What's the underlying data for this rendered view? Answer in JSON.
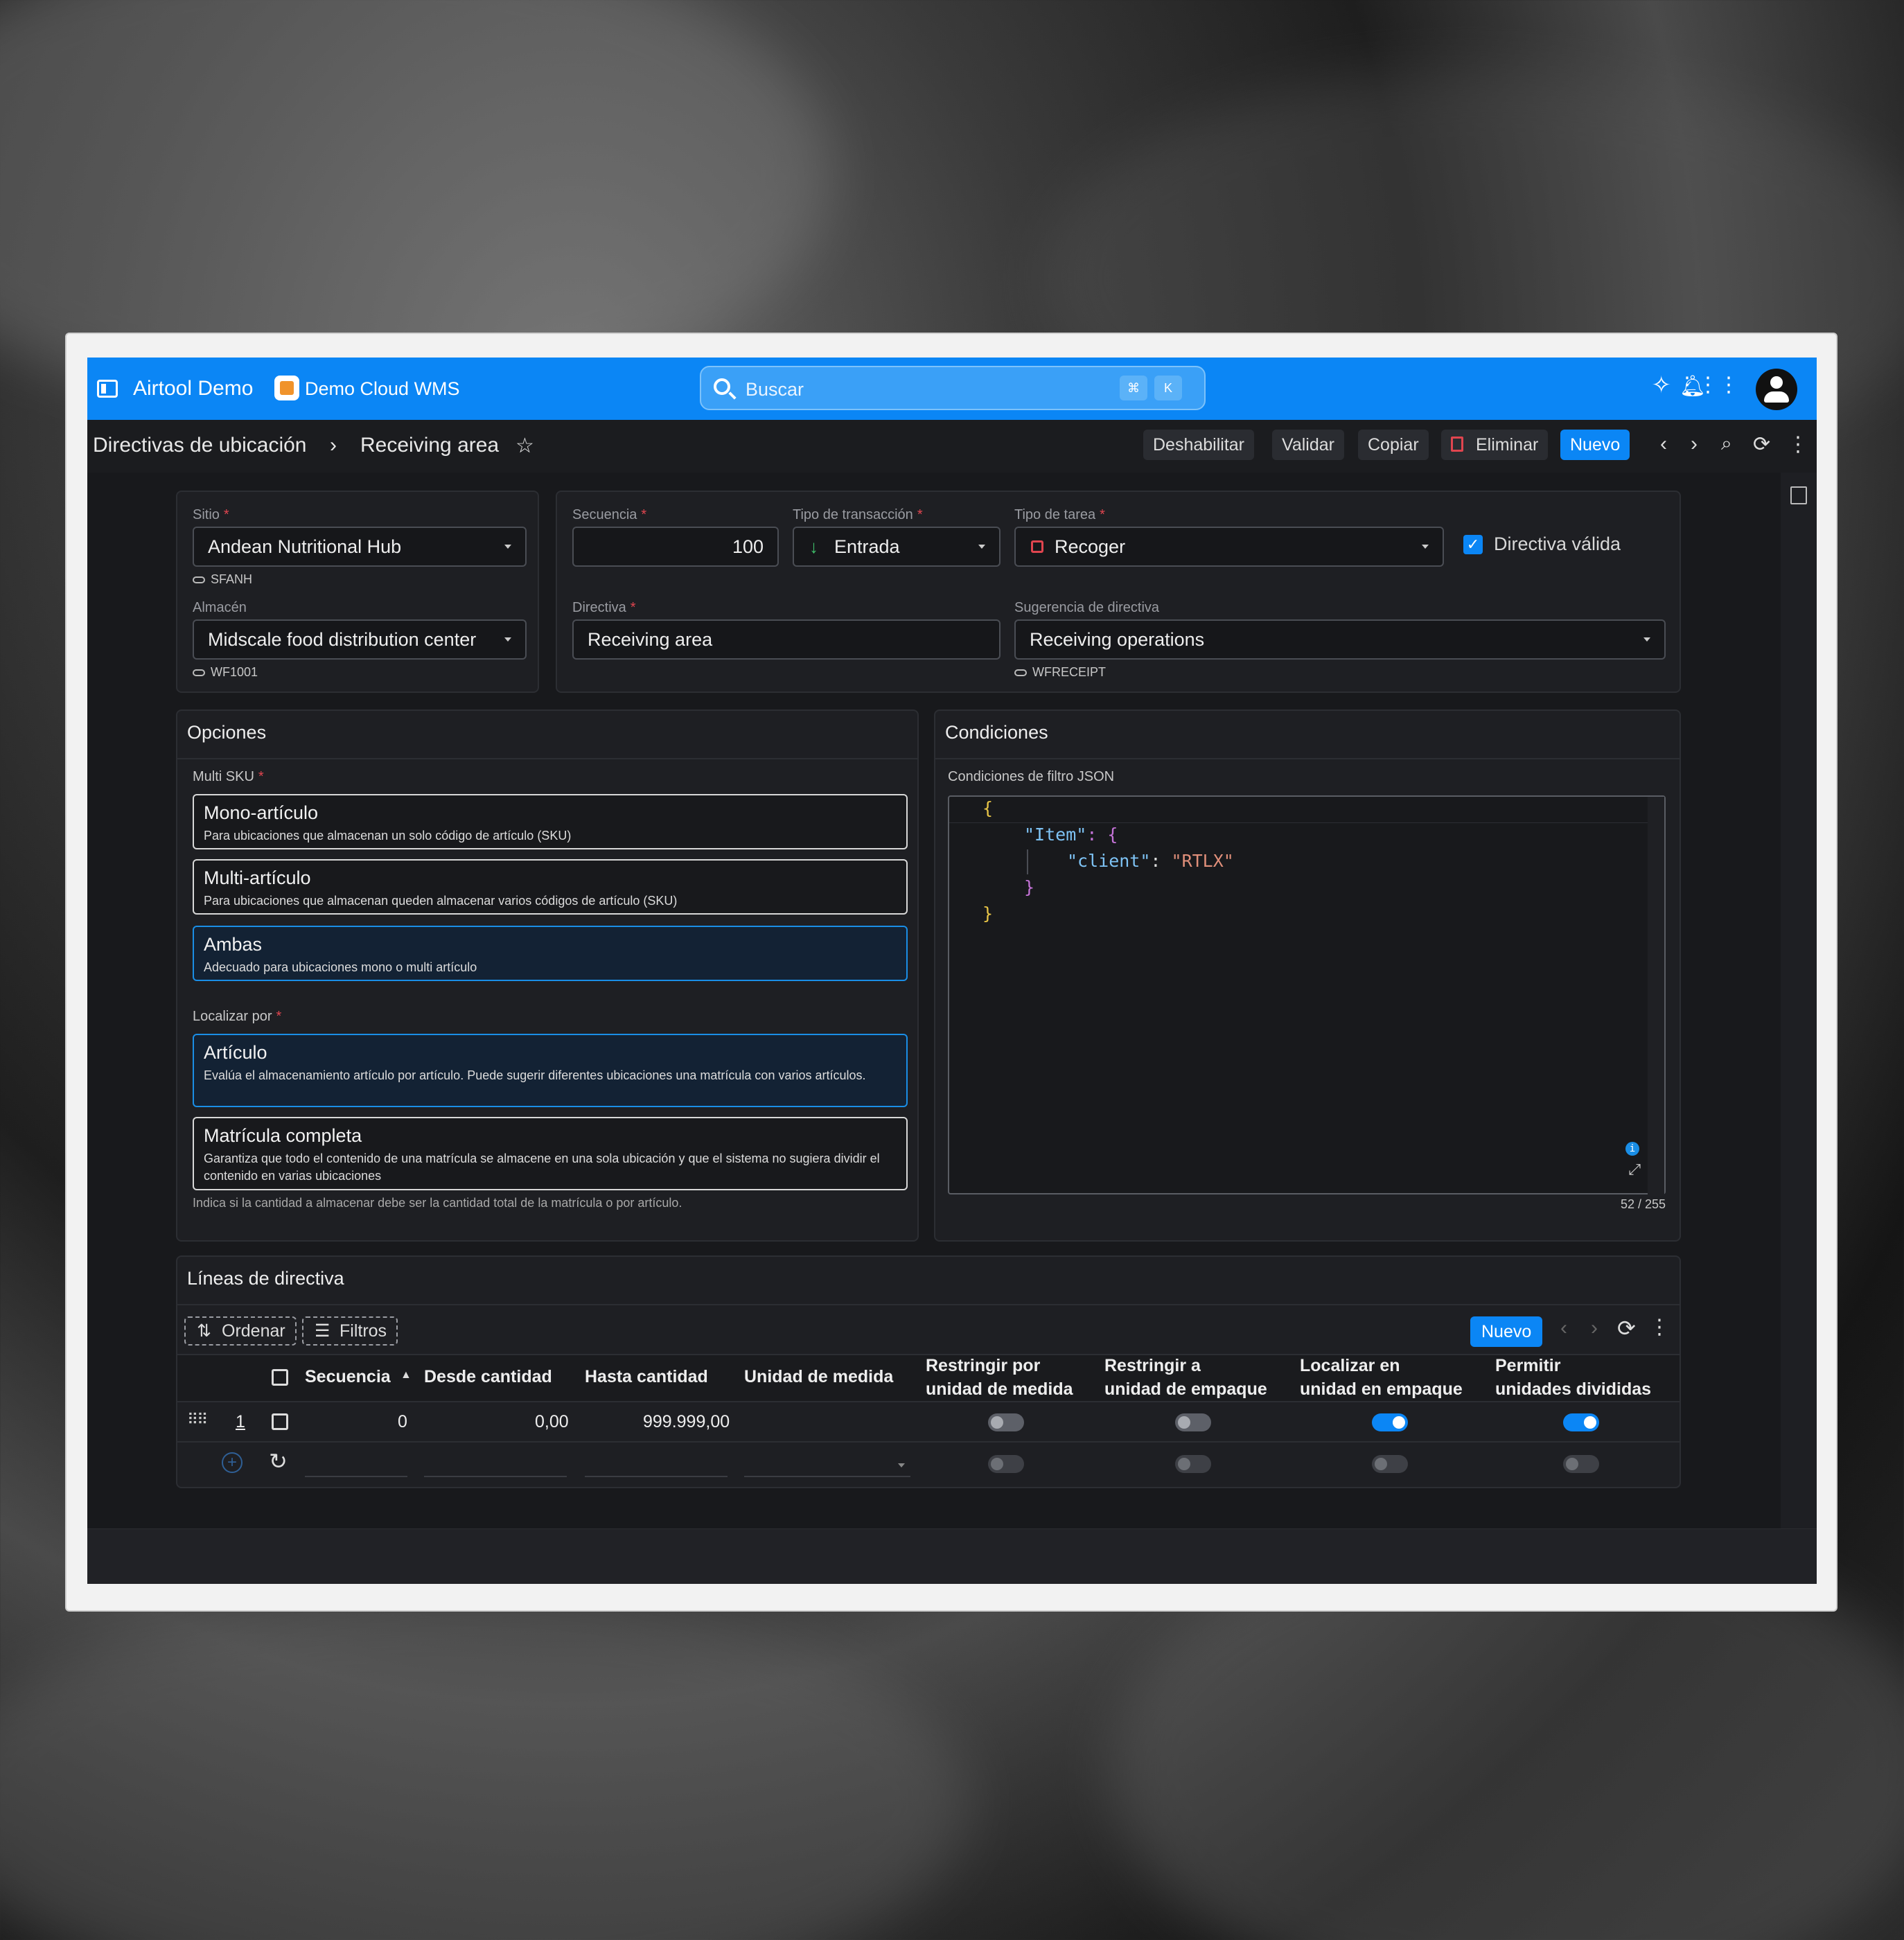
{
  "topbar": {
    "app_name": "Airtool Demo",
    "module_name": "Demo Cloud WMS",
    "search_placeholder": "Buscar",
    "shortcut_1": "⌘",
    "shortcut_2": "K"
  },
  "breadcrumb": {
    "parent": "Directivas de ubicación",
    "separator": "›",
    "current": "Receiving area"
  },
  "toolbar": {
    "disable": "Deshabilitar",
    "validate": "Validar",
    "copy": "Copiar",
    "delete": "Eliminar",
    "new": "Nuevo"
  },
  "header": {
    "site_label": "Sitio",
    "site_value": "Andean Nutritional Hub",
    "site_code": "SFANH",
    "warehouse_label": "Almacén",
    "warehouse_value": "Midscale food distribution center",
    "warehouse_code": "WF1001",
    "sequence_label": "Secuencia",
    "sequence_value": "100",
    "transaction_label": "Tipo de transacción",
    "transaction_value": "Entrada",
    "task_label": "Tipo de tarea",
    "task_value": "Recoger",
    "valid_label": "Directiva válida",
    "directive_label": "Directiva",
    "directive_value": "Receiving area",
    "suggestion_label": "Sugerencia de directiva",
    "suggestion_value": "Receiving operations",
    "suggestion_code": "WFRECEIPT"
  },
  "options": {
    "title": "Opciones",
    "multi_sku_label": "Multi SKU",
    "multi_sku_items": [
      {
        "title": "Mono-artículo",
        "desc": "Para ubicaciones que almacenan un solo código de artículo (SKU)"
      },
      {
        "title": "Multi-artículo",
        "desc": "Para ubicaciones que almacenan queden almacenar varios códigos de artículo (SKU)"
      },
      {
        "title": "Ambas",
        "desc": "Adecuado para ubicaciones mono o multi artículo"
      }
    ],
    "locate_label": "Localizar por",
    "locate_items": [
      {
        "title": "Artículo",
        "desc": "Evalúa el almacenamiento artículo por artículo. Puede sugerir diferentes ubicaciones una matrícula con varios artículos."
      },
      {
        "title": "Matrícula completa",
        "desc": "Garantiza que todo el contenido de una matrícula se almacene en una sola ubicación y que el sistema no sugiera dividir el contenido en varias ubicaciones"
      }
    ],
    "locate_hint": "Indica si la cantidad a almacenar debe ser la cantidad total de la matrícula o por artículo."
  },
  "conditions": {
    "title": "Condiciones",
    "json_label": "Condiciones de filtro JSON",
    "code_lines": {
      "l1": "{",
      "l2_key": "\"Item\"",
      "l2_rest": ": {",
      "l3_key": "\"client\"",
      "l3_colon": ": ",
      "l3_value": "\"RTLX\"",
      "l4": "}",
      "l5": "}"
    },
    "counter": "52 / 255"
  },
  "lines": {
    "title": "Líneas de directiva",
    "sort": "Ordenar",
    "filters": "Filtros",
    "new": "Nuevo",
    "columns": {
      "sequence": "Secuencia",
      "from_qty": "Desde cantidad",
      "to_qty": "Hasta cantidad",
      "uom": "Unidad de medida",
      "restrict_uom_1": "Restringir por",
      "restrict_uom_2": "unidad de medida",
      "restrict_pack_1": "Restringir a",
      "restrict_pack_2": "unidad de empaque",
      "locate_pack_1": "Localizar en",
      "locate_pack_2": "unidad en empaque",
      "allow_split_1": "Permitir",
      "allow_split_2": "unidades divididas"
    },
    "rows": [
      {
        "index": "1",
        "sequence": "0",
        "from_qty": "0,00",
        "to_qty": "999.999,00",
        "uom": ""
      }
    ]
  },
  "colors": {
    "accent": "#0b86f5",
    "required": "#e0454f",
    "json_key": "#7ec3f5",
    "json_string": "#e08f7a",
    "brace_1": "#e8c547",
    "brace_2": "#c573d8"
  }
}
